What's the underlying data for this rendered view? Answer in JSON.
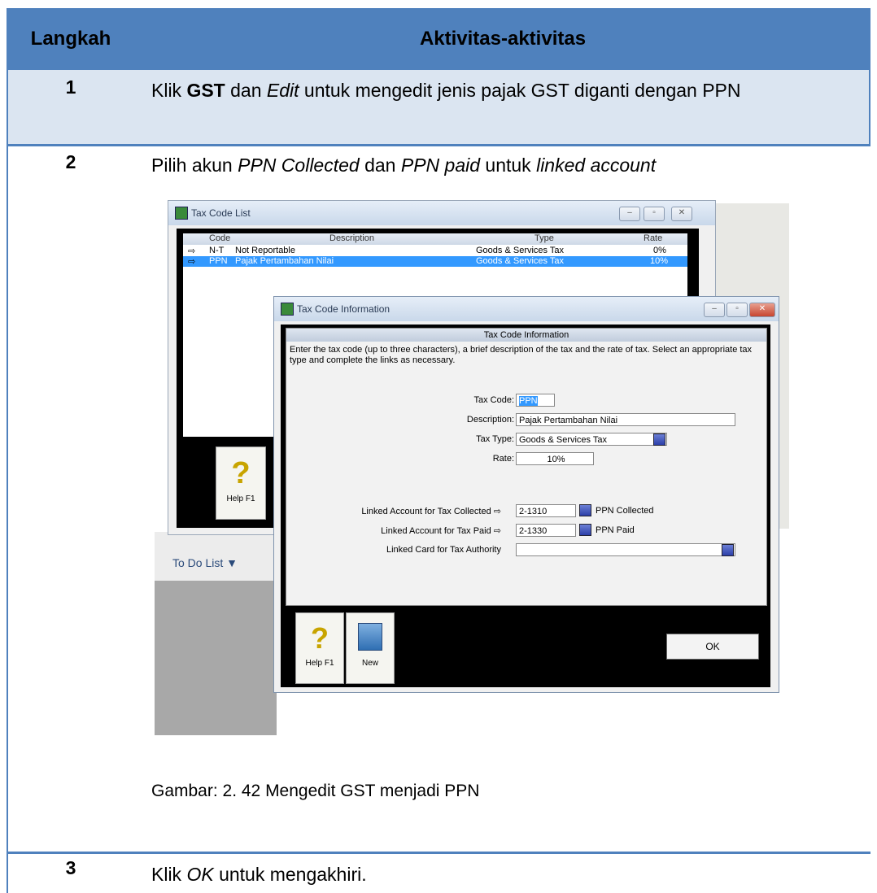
{
  "table": {
    "header": {
      "col1": "Langkah",
      "col2": "Aktivitas-aktivitas"
    },
    "rows": [
      {
        "num": "1",
        "parts": [
          "Klik ",
          "GST",
          " dan ",
          "Edit",
          "  untuk mengedit jenis pajak GST diganti dengan PPN"
        ]
      },
      {
        "num": "2",
        "parts": [
          "Pilih akun ",
          "PPN Collected",
          " dan ",
          "PPN paid",
          " untuk ",
          "linked account"
        ],
        "caption": "Gambar: 2. 42 Mengedit GST menjadi PPN"
      },
      {
        "num": "3",
        "parts": [
          "Klik ",
          "OK",
          " untuk mengakhiri."
        ]
      }
    ]
  },
  "screenshot": {
    "list_window": {
      "title": "Tax Code List",
      "columns": [
        "Code",
        "Description",
        "Type",
        "Rate"
      ],
      "rows": [
        {
          "code": "N-T",
          "description": "Not Reportable",
          "type": "Goods & Services Tax",
          "rate": "0%"
        },
        {
          "code": "PPN",
          "description": "Pajak Pertambahan Nilai",
          "type": "Goods & Services Tax",
          "rate": "10%"
        }
      ],
      "help_label": "Help F1",
      "todo_label": "To Do List"
    },
    "info_window": {
      "title": "Tax Code Information",
      "panel_title": "Tax Code Information",
      "instructions": "Enter the tax code (up to three characters), a brief description of the tax and the rate of tax. Select an appropriate tax type and complete the links as necessary.",
      "fields": {
        "tax_code_label": "Tax Code:",
        "tax_code_value": "PPN",
        "description_label": "Description:",
        "description_value": "Pajak Pertambahan Nilai",
        "tax_type_label": "Tax Type:",
        "tax_type_value": "Goods & Services Tax",
        "rate_label": "Rate:",
        "rate_value": "10%",
        "collected_label": "Linked Account for Tax Collected",
        "collected_account": "2-1310",
        "collected_name": "PPN Collected",
        "paid_label": "Linked Account for Tax Paid",
        "paid_account": "2-1330",
        "paid_name": "PPN Paid",
        "authority_label": "Linked Card for Tax Authority",
        "authority_value": ""
      },
      "help_label": "Help F1",
      "new_label": "New",
      "ok_label": "OK"
    },
    "icons": [
      "help-icon",
      "new-icon",
      "arrow-right-icon",
      "dropdown-arrow-icon",
      "minimize-icon",
      "maximize-icon",
      "close-icon"
    ]
  },
  "colors": {
    "header": "#4f81bd",
    "row_shade": "#dbe5f1",
    "selection": "#3399ff"
  }
}
